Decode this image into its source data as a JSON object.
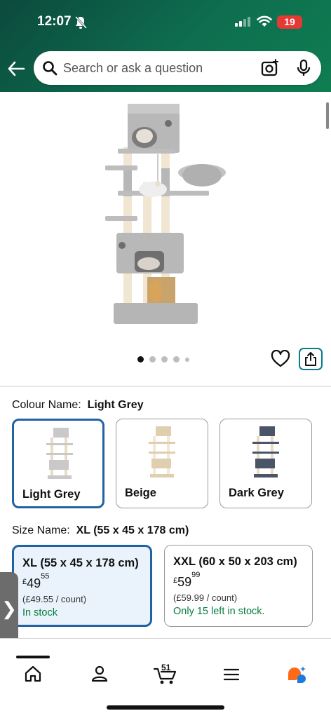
{
  "status": {
    "time": "12:07",
    "battery": "19"
  },
  "search": {
    "placeholder": "Search or ask a question"
  },
  "gallery": {
    "image_count": 5,
    "active_index": 0
  },
  "colour": {
    "label": "Colour Name:",
    "value": "Light Grey",
    "options": [
      {
        "name": "Light Grey",
        "color": "#c9c9c9",
        "selected": true
      },
      {
        "name": "Beige",
        "color": "#e0cfae",
        "selected": false
      },
      {
        "name": "Dark Grey",
        "color": "#4a5668",
        "selected": false
      }
    ]
  },
  "size": {
    "label": "Size Name:",
    "value": "XL (55 x 45 x 178 cm)",
    "options": [
      {
        "title": "XL (55 x 45 x 178 cm)",
        "currency": "£",
        "price_whole": "49",
        "price_fraction": "55",
        "per_count": "(£49.55 / count)",
        "stock": "In stock",
        "selected": true
      },
      {
        "title": "XXL (60 x 50 x 203 cm)",
        "currency": "£",
        "price_whole": "59",
        "price_fraction": "99",
        "per_count": "(£59.99 / count)",
        "stock": "Only 15 left in stock.",
        "selected": false
      }
    ]
  },
  "side_tab": {
    "glyph": "❯"
  },
  "nav": {
    "cart_count": "51",
    "items": [
      "home-icon",
      "account-icon",
      "cart-icon",
      "menu-icon",
      "rufus-icon"
    ]
  },
  "colors": {
    "header": "#0e6e4f",
    "selected_border": "#2162a1",
    "stock_green": "#067d3f",
    "share_accent": "#0a7c8c"
  }
}
